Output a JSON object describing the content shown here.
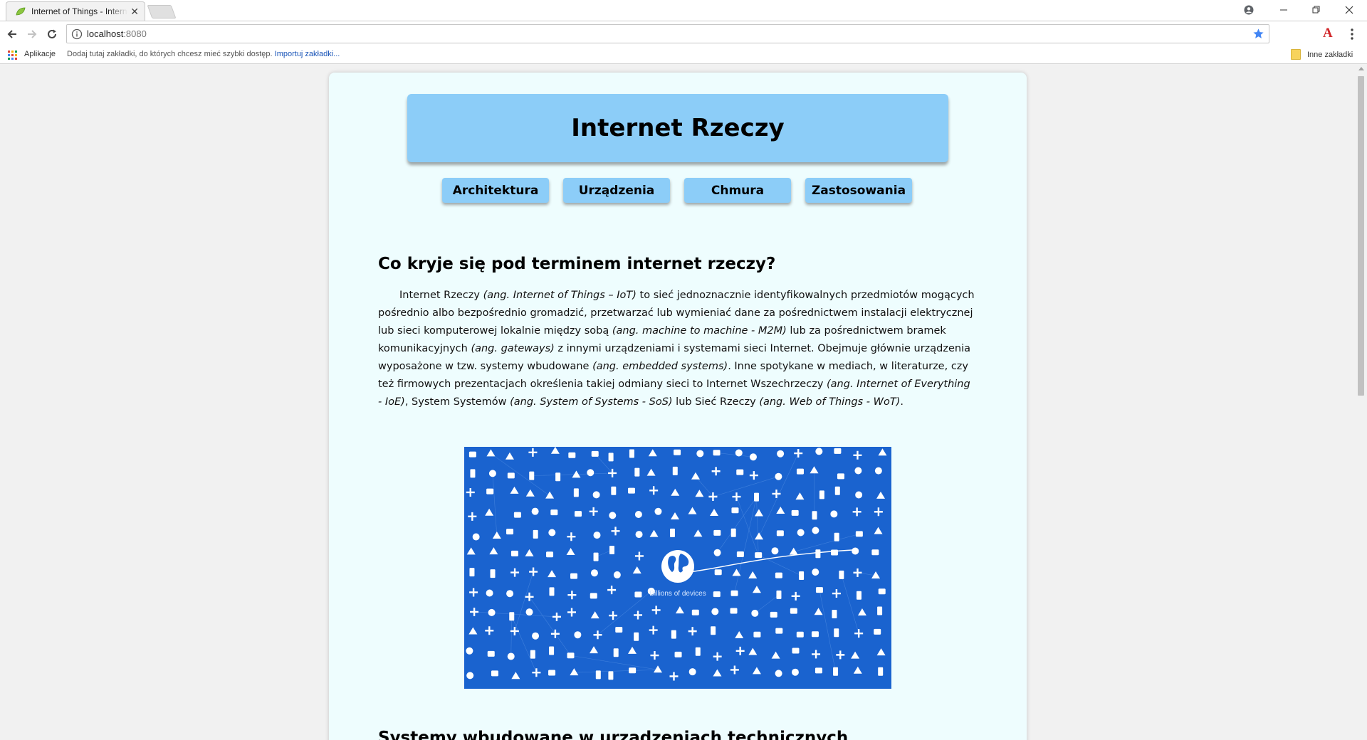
{
  "browser": {
    "tab_title": "Internet of Things - Internet Rzeczy",
    "url_host": "localhost",
    "url_port": ":8080",
    "bookmarks_bar": {
      "apps_label": "Aplikacje",
      "hint": "Dodaj tutaj zakładki, do których chcesz mieć szybki dostęp.",
      "import_link": "Importuj zakładki...",
      "other_bookmarks": "Inne zakładki"
    }
  },
  "site": {
    "title": "Internet Rzeczy",
    "nav": [
      "Architektura",
      "Urządzenia",
      "Chmura",
      "Zastosowania"
    ]
  },
  "article": {
    "heading1": "Co kryje się pod terminem internet rzeczy?",
    "intro": {
      "t1": "Internet Rzeczy ",
      "i1": "(ang. Internet of Things – IoT)",
      "t2": " to sieć jednoznacznie identyfikowalnych przedmiotów mogących pośrednio albo bezpośrednio gromadzić, przetwarzać lub wymieniać dane za pośrednictwem instalacji elektrycznej lub sieci komputerowej lokalnie między sobą ",
      "i2": "(ang. machine to machine - M2M)",
      "t3": " lub za pośrednictwem bramek komunikacyjnych ",
      "i3": "(ang. gateways)",
      "t4": " z innymi urządzeniami i systemami sieci Internet. Obejmuje głównie urządzenia wyposażone w tzw. systemy wbudowane ",
      "i4": "(ang. embedded systems)",
      "t5": ". Inne spotykane w mediach, w literaturze, czy też firmowych prezentacjach określenia takiej odmiany sieci to Internet Wszechrzeczy ",
      "i5": "(ang. Internet of Everything - IoE)",
      "t6": ", System Systemów ",
      "i6": "(ang. System of Systems - SoS)",
      "t7": " lub Sieć Rzeczy ",
      "i7": "(ang. Web of Things - WoT)",
      "t8": "."
    },
    "image_caption": "Billions of devices",
    "heading2": "Systemy wbudowane w urządzeniach technicznych"
  },
  "colors": {
    "header_bg": "#8ccdf8",
    "page_bg": "#eefdfe",
    "image_bg": "#1a63cf"
  }
}
